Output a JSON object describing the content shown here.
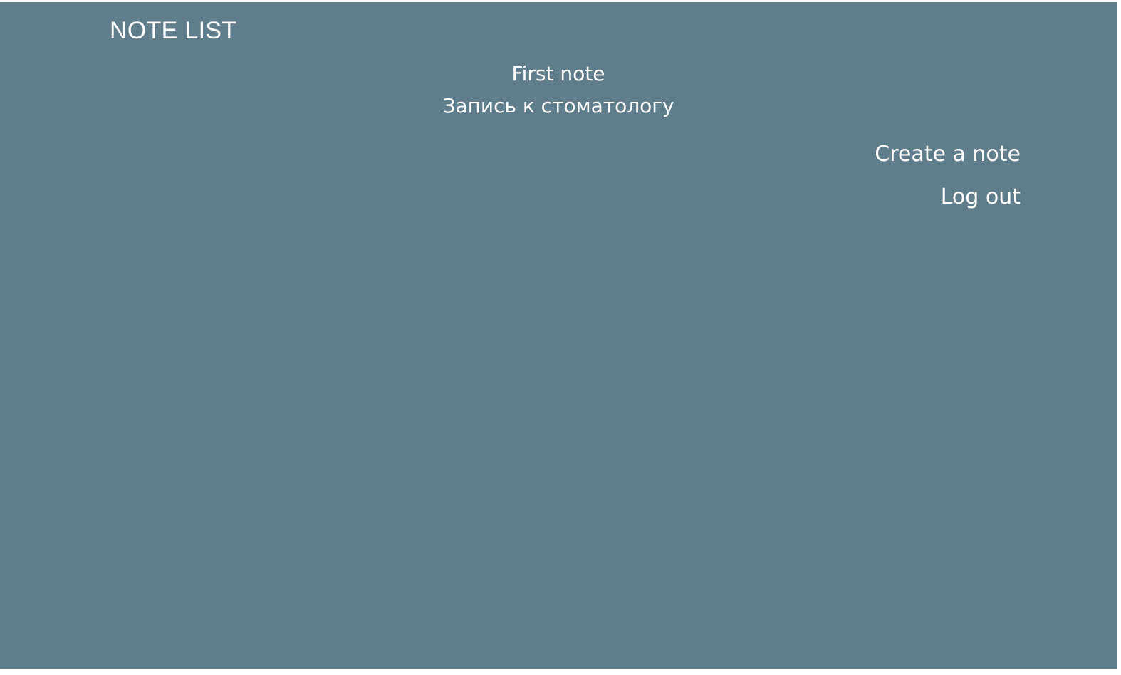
{
  "header": {
    "title": "NOTE LIST"
  },
  "notes": [
    {
      "title": "First note"
    },
    {
      "title": "Запись к стоматологу"
    }
  ],
  "actions": {
    "create_label": "Create a note",
    "logout_label": "Log out"
  },
  "colors": {
    "background": "#607d8b",
    "text": "#ffffff"
  }
}
